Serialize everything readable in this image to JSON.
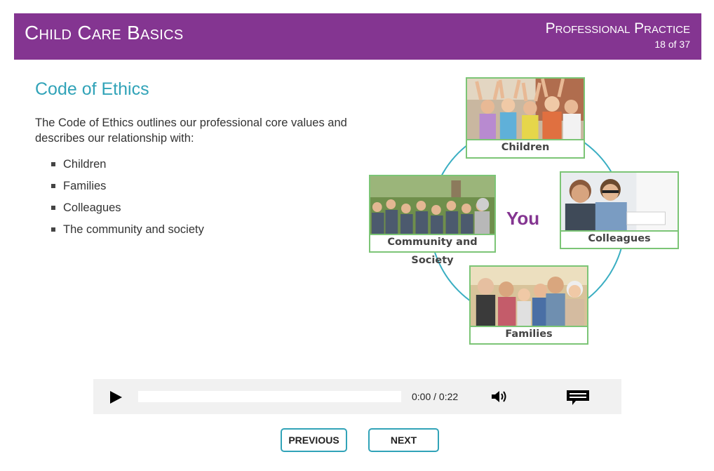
{
  "header": {
    "course_title": "Child Care Basics",
    "section_title": "Professional Practice",
    "page_indicator": "18 of 37"
  },
  "content": {
    "title": "Code of Ethics",
    "intro": "The Code of Ethics outlines our professional core values and describes our relationship with:",
    "bullets": [
      "Children",
      "Families",
      "Colleagues",
      "The community and society"
    ]
  },
  "diagram": {
    "center_label": "You",
    "cards": {
      "children": "Children",
      "colleagues": "Colleagues",
      "families": "Families",
      "community": "Community and Society"
    }
  },
  "player": {
    "time": "0:00 / 0:22",
    "progress": 0
  },
  "nav": {
    "previous": "PREVIOUS",
    "next": "NEXT"
  },
  "colors": {
    "header_bg": "#843591",
    "accent_teal": "#31a3b8",
    "card_border": "#7cc576"
  }
}
